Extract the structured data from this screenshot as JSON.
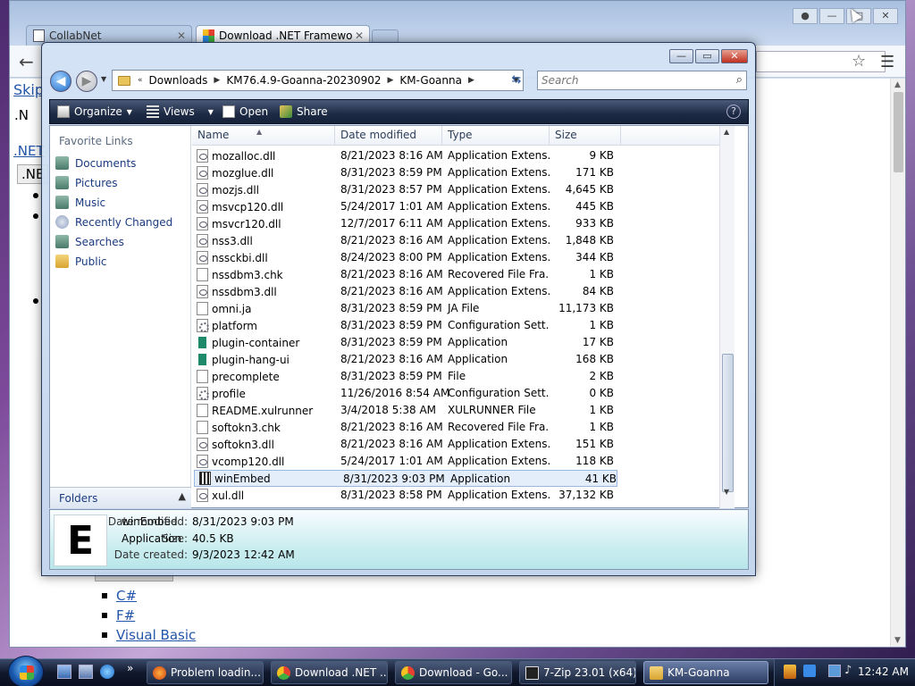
{
  "browser": {
    "tabs": [
      {
        "label": "CollabNet",
        "active": false
      },
      {
        "label": "Download .NET Framewo",
        "active": true
      }
    ],
    "page": {
      "skip_link": "Skip",
      "fragments": [
        ".N",
        ".NET",
        ".NE"
      ],
      "languages": [
        "C#",
        "F#",
        "Visual Basic"
      ]
    }
  },
  "explorer": {
    "breadcrumb": [
      "Downloads",
      "KM76.4.9-Goanna-20230902",
      "KM-Goanna"
    ],
    "search_placeholder": "Search",
    "toolbar": {
      "organize": "Organize",
      "views": "Views",
      "open": "Open",
      "share": "Share"
    },
    "favorites_heading": "Favorite Links",
    "favorites": [
      "Documents",
      "Pictures",
      "Music",
      "Recently Changed",
      "Searches",
      "Public"
    ],
    "folders_label": "Folders",
    "columns": [
      "Name",
      "Date modified",
      "Type",
      "Size"
    ],
    "files": [
      {
        "name": "mozalloc.dll",
        "date": "8/21/2023 8:16 AM",
        "type": "Application Extens...",
        "size": "9 KB",
        "icon": "dll"
      },
      {
        "name": "mozglue.dll",
        "date": "8/31/2023 8:59 PM",
        "type": "Application Extens...",
        "size": "171 KB",
        "icon": "dll"
      },
      {
        "name": "mozjs.dll",
        "date": "8/31/2023 8:57 PM",
        "type": "Application Extens...",
        "size": "4,645 KB",
        "icon": "dll"
      },
      {
        "name": "msvcp120.dll",
        "date": "5/24/2017 1:01 AM",
        "type": "Application Extens...",
        "size": "445 KB",
        "icon": "dll"
      },
      {
        "name": "msvcr120.dll",
        "date": "12/7/2017 6:11 AM",
        "type": "Application Extens...",
        "size": "933 KB",
        "icon": "dll"
      },
      {
        "name": "nss3.dll",
        "date": "8/21/2023 8:16 AM",
        "type": "Application Extens...",
        "size": "1,848 KB",
        "icon": "dll"
      },
      {
        "name": "nssckbi.dll",
        "date": "8/24/2023 8:00 PM",
        "type": "Application Extens...",
        "size": "344 KB",
        "icon": "dll"
      },
      {
        "name": "nssdbm3.chk",
        "date": "8/21/2023 8:16 AM",
        "type": "Recovered File Fra...",
        "size": "1 KB",
        "icon": "file"
      },
      {
        "name": "nssdbm3.dll",
        "date": "8/21/2023 8:16 AM",
        "type": "Application Extens...",
        "size": "84 KB",
        "icon": "dll"
      },
      {
        "name": "omni.ja",
        "date": "8/31/2023 8:59 PM",
        "type": "JA File",
        "size": "11,173 KB",
        "icon": "file"
      },
      {
        "name": "platform",
        "date": "8/31/2023 8:59 PM",
        "type": "Configuration Sett...",
        "size": "1 KB",
        "icon": "cfg"
      },
      {
        "name": "plugin-container",
        "date": "8/31/2023 8:59 PM",
        "type": "Application",
        "size": "17 KB",
        "icon": "app"
      },
      {
        "name": "plugin-hang-ui",
        "date": "8/21/2023 8:16 AM",
        "type": "Application",
        "size": "168 KB",
        "icon": "app"
      },
      {
        "name": "precomplete",
        "date": "8/31/2023 8:59 PM",
        "type": "File",
        "size": "2 KB",
        "icon": "file"
      },
      {
        "name": "profile",
        "date": "11/26/2016 8:54 AM",
        "type": "Configuration Sett...",
        "size": "0 KB",
        "icon": "cfg"
      },
      {
        "name": "README.xulrunner",
        "date": "3/4/2018 5:38 AM",
        "type": "XULRUNNER File",
        "size": "1 KB",
        "icon": "file"
      },
      {
        "name": "softokn3.chk",
        "date": "8/21/2023 8:16 AM",
        "type": "Recovered File Fra...",
        "size": "1 KB",
        "icon": "file"
      },
      {
        "name": "softokn3.dll",
        "date": "8/21/2023 8:16 AM",
        "type": "Application Extens...",
        "size": "151 KB",
        "icon": "dll"
      },
      {
        "name": "vcomp120.dll",
        "date": "5/24/2017 1:01 AM",
        "type": "Application Extens...",
        "size": "118 KB",
        "icon": "dll"
      },
      {
        "name": "winEmbed",
        "date": "8/31/2023 9:03 PM",
        "type": "Application",
        "size": "41 KB",
        "icon": "embed",
        "selected": true
      },
      {
        "name": "xul.dll",
        "date": "8/31/2023 8:58 PM",
        "type": "Application Extens...",
        "size": "37,132 KB",
        "icon": "dll"
      }
    ],
    "details": {
      "icon_letter": "E",
      "name": "winEmbed",
      "type": "Application",
      "date_modified_label": "Date modified:",
      "date_modified": "8/31/2023 9:03 PM",
      "size_label": "Size:",
      "size": "40.5 KB",
      "date_created_label": "Date created:",
      "date_created": "9/3/2023 12:42 AM"
    }
  },
  "taskbar": {
    "buttons": [
      "Problem loadin...",
      "Download .NET ...",
      "Download - Go...",
      "7-Zip 23.01 (x64)...",
      "KM-Goanna"
    ],
    "clock": "12:42 AM"
  }
}
